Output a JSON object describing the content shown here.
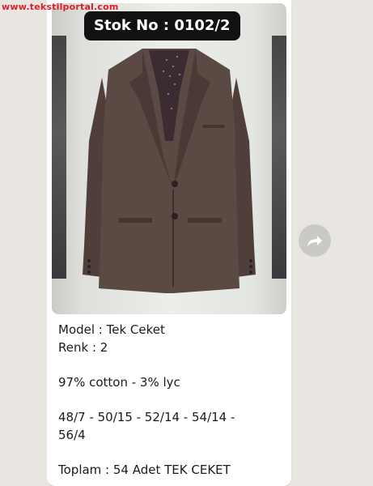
{
  "watermark": "www.tekstilportal.com",
  "message": {
    "stock_label": "Stok No : 0102/2",
    "caption": {
      "model": "Model : Tek Ceket",
      "color": "Renk : 2",
      "fabric": "97% cotton - 3% lyc",
      "sizes_line1": "48/7 - 50/15 - 52/14 - 54/14 -",
      "sizes_line2": "56/4",
      "total": "Toplam : 54 Adet TEK CEKET"
    }
  },
  "forward_button": {
    "icon": "forward-arrow-icon"
  },
  "colors": {
    "background": "#e9e6e2",
    "bubble": "#ffffff",
    "badge": "#111111",
    "jacket": "#5b4944",
    "watermark": "#d9212a",
    "forward_button": "#c9c9c6"
  }
}
